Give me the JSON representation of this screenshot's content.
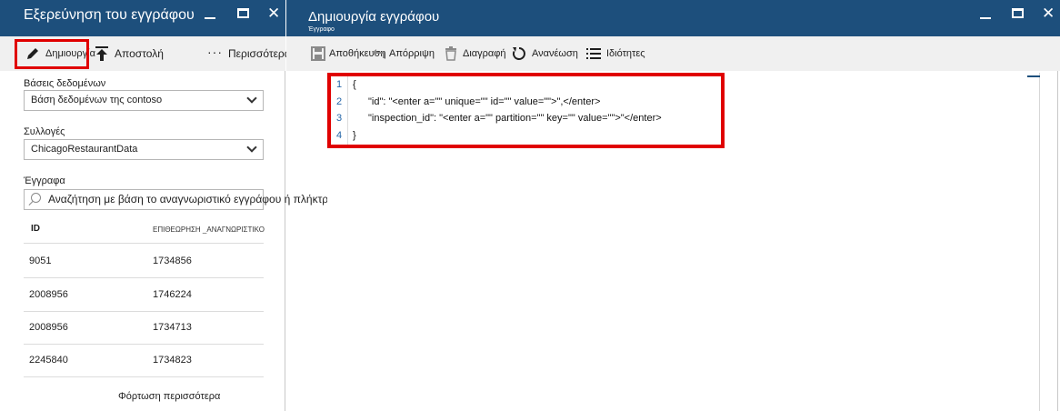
{
  "left_blade": {
    "title": "Εξερεύνηση του εγγράφου",
    "commands": {
      "create": "Δημιουργία",
      "upload": "Αποστολή",
      "more": "Περισσότερα"
    },
    "databases": {
      "label": "Βάσεις δεδομένων",
      "selected": "Βάση δεδομένων της contoso"
    },
    "collections": {
      "label": "Συλλογές",
      "selected": "ChicagoRestaurantData"
    },
    "documents": {
      "label": "Έγγραφα",
      "search_placeholder": "Αναζήτηση με βάση το αναγνωριστικό εγγράφου ή πλήκτρο Partition",
      "columns": [
        "ID",
        "ΕΠΙΘΕΩΡΗΣΗ _ΑΝΑΓΝΩΡΙΣΤΙΚΟ"
      ],
      "rows": [
        [
          "9051",
          "1734856"
        ],
        [
          "2008956",
          "1746224"
        ],
        [
          "2008956",
          "1734713"
        ],
        [
          "2245840",
          "1734823"
        ]
      ],
      "load_more": "Φόρτωση περισσότερα"
    }
  },
  "right_blade": {
    "title": "Δημιουργία εγγράφου",
    "subtitle": "Έγγραφο",
    "commands": {
      "save": "Αποθήκευση",
      "discard": "Απόρριψη",
      "delete": "Διαγραφή",
      "refresh": "Ανανέωση",
      "properties": "Ιδιότητες"
    },
    "editor": {
      "line_numbers": [
        "1",
        "2",
        "3",
        "4"
      ],
      "lines": [
        "{",
        "\"id\": \"<enter a=\"\" unique=\"\" id=\"\" value=\"\">\",</enter>",
        "\"inspection_id\": \"<enter a=\"\" partition=\"\" key=\"\" value=\"\">\"</enter>",
        "}"
      ]
    }
  },
  "colors": {
    "header": "#1d4f7c",
    "command_bar": "#f0f0f0",
    "highlight": "#e00000",
    "line_number": "#2566a8"
  }
}
